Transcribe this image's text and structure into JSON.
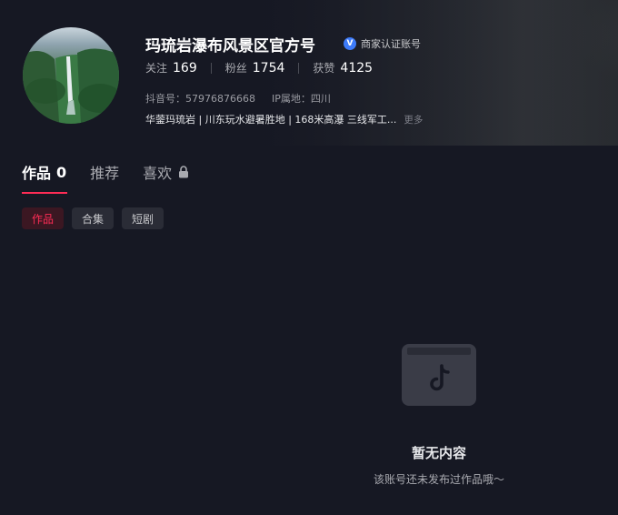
{
  "profile": {
    "name": "玛琉岩瀑布风景区官方号",
    "verify_badge": "V",
    "verify_label": "商家认证账号",
    "stats": [
      {
        "label": "关注",
        "value": "169"
      },
      {
        "label": "粉丝",
        "value": "1754"
      },
      {
        "label": "获赞",
        "value": "4125"
      }
    ],
    "douyin_id": "抖音号：57976876668",
    "ip_location": "IP属地：四川",
    "bio": "华蓥玛琉岩 | 川东玩水避暑胜地 | 168米高瀑 三线军工...",
    "bio_more": "更多"
  },
  "tabs": [
    {
      "label": "作品",
      "count": "0"
    },
    {
      "label": "推荐"
    },
    {
      "label": "喜欢"
    }
  ],
  "chips": [
    "作品",
    "合集",
    "短剧"
  ],
  "empty": {
    "title": "暂无内容",
    "subtitle": "该账号还未发布过作品哦～"
  },
  "colors": {
    "background": "#161823",
    "accent": "#fe2c55",
    "verify": "#3d7bfa"
  },
  "icons": {
    "verify": "verified-badge-icon",
    "lock": "lock-icon",
    "empty": "tiktok-folder-icon"
  }
}
